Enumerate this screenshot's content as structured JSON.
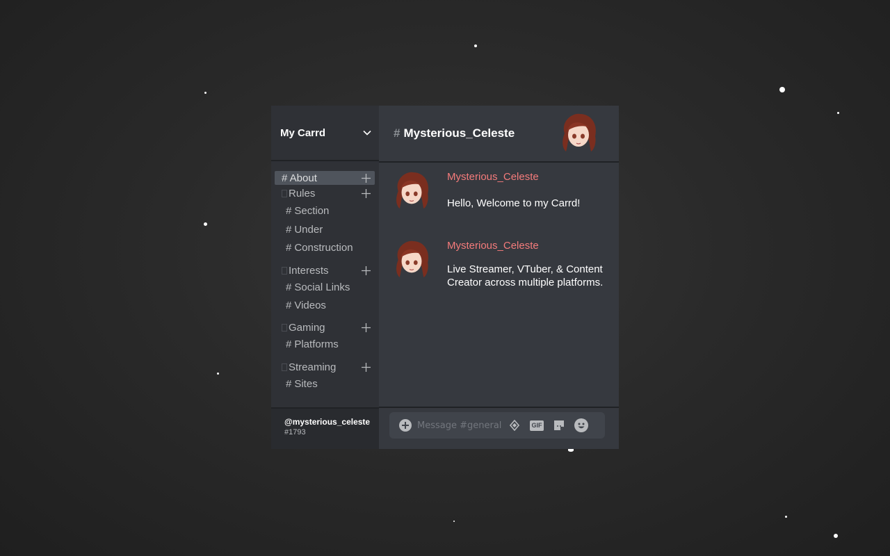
{
  "server": {
    "name": "My Carrd"
  },
  "sidebar": {
    "groups": [
      {
        "label": "# About",
        "channels": []
      },
      {
        "label": "Rules",
        "channels": [
          "Section",
          "Under",
          "Construction"
        ]
      },
      {
        "label": "Interests",
        "channels": [
          "Social Links",
          "Videos"
        ]
      },
      {
        "label": "Gaming",
        "channels": [
          "Platforms"
        ]
      },
      {
        "label": "Streaming",
        "channels": [
          "Sites"
        ]
      }
    ]
  },
  "user": {
    "name": "@mysterious_celeste",
    "tag": "#1793"
  },
  "channel": {
    "hash": "#",
    "name": "Mysterious_Celeste"
  },
  "messages": [
    {
      "author": "Mysterious_Celeste",
      "text": "Hello, Welcome to my Carrd!"
    },
    {
      "author": "Mysterious_Celeste",
      "text": "Live Streamer, VTuber, & Content Creator across multiple platforms."
    }
  ],
  "composer": {
    "placeholder": "Message #general",
    "gif_label": "GIF"
  },
  "colors": {
    "sidebar": "#2f3136",
    "chat": "#36393f",
    "author": "#f47b7b",
    "active": "#4f545c"
  },
  "icons": [
    "chevron-down-icon",
    "plus-icon",
    "add-circle-icon",
    "nitro-gem-icon",
    "gif-icon",
    "sticker-icon",
    "emoji-icon"
  ]
}
